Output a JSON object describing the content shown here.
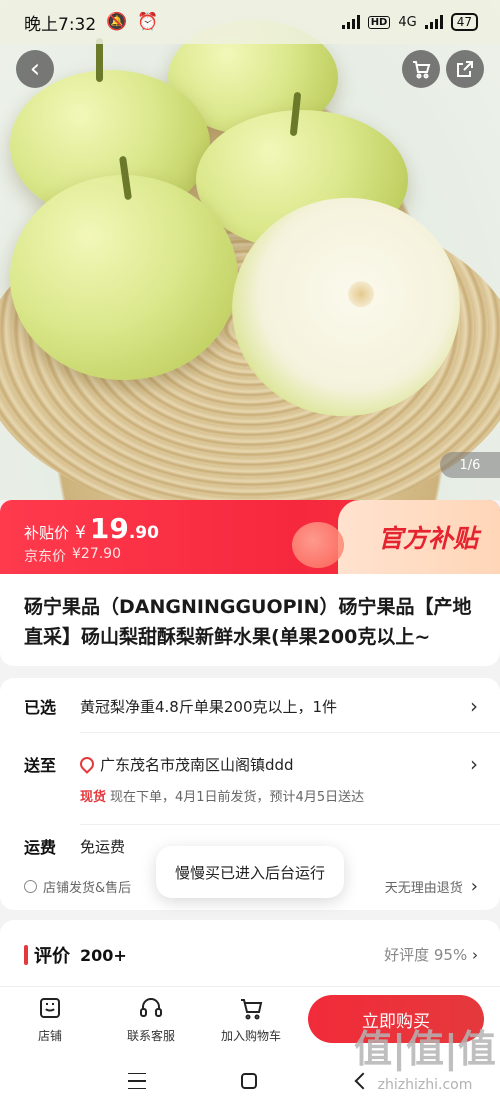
{
  "status_bar": {
    "time": "晚上7:32",
    "network": "4G",
    "battery": "47"
  },
  "hero": {
    "pager": "1/6"
  },
  "price": {
    "subsidy_label": "补贴价",
    "currency": "¥",
    "subsidy_price_int": "19",
    "subsidy_price_dec": ".90",
    "jd_label": "京东价",
    "jd_price": "¥27.90",
    "badge_text": "官方补贴"
  },
  "product": {
    "title": "砀宁果品（DANGNINGGUOPIN）砀宁果品【产地直采】砀山梨甜酥梨新鲜水果(单果200克以上~"
  },
  "spec": {
    "selected_label": "已选",
    "selected_value": "黄冠梨净重4.8斤单果200克以上，1件",
    "ship_to_label": "送至",
    "address": "广东茂名市茂南区山阁镇ddd",
    "stock_status": "现货",
    "delivery_note": "现在下单，4月1日前发货，预计4月5日送达",
    "freight_label": "运费",
    "freight_value": "免运费",
    "service_left": "店铺发货&售后",
    "service_right": "天无理由退货"
  },
  "toast": {
    "text": "慢慢买已进入后台运行"
  },
  "reviews": {
    "title": "评价",
    "count": "200+",
    "rate": "好评度 95%"
  },
  "actions": {
    "shop": "店铺",
    "service": "联系客服",
    "add_cart": "加入购物车",
    "buy_now": "立即购买"
  },
  "watermark": {
    "logo": "值|值|值",
    "site": "zhizhizhi.com"
  },
  "icons": {
    "back": "chevron-left-icon",
    "cart": "cart-icon",
    "share": "share-icon",
    "location": "location-pin-icon"
  },
  "colors": {
    "accent": "#e4393c",
    "banner_red": "#f6283e",
    "badge_bg": "#ffd6b8"
  }
}
